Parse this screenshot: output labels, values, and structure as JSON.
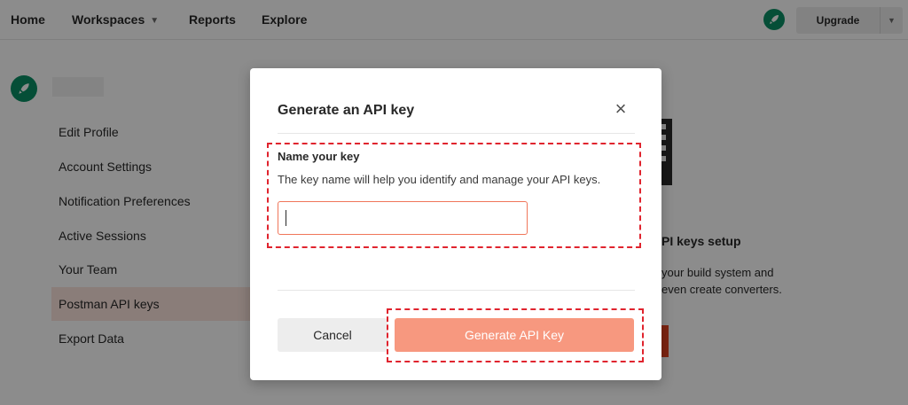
{
  "nav": {
    "home": "Home",
    "workspaces": "Workspaces",
    "reports": "Reports",
    "explore": "Explore",
    "upgrade": "Upgrade"
  },
  "sidebar": {
    "items": [
      {
        "label": "Edit Profile"
      },
      {
        "label": "Account Settings"
      },
      {
        "label": "Notification Preferences"
      },
      {
        "label": "Active Sessions"
      },
      {
        "label": "Your Team"
      },
      {
        "label": "Postman API keys",
        "active": true
      },
      {
        "label": "Export Data"
      }
    ]
  },
  "background": {
    "title_fragment": "PI keys setup",
    "line1_fragment": "your build system and",
    "line2_fragment": "even create converters."
  },
  "modal": {
    "title": "Generate an API key",
    "field_label": "Name your key",
    "field_description": "The key name will help you identify and manage your API keys.",
    "input_value": "",
    "cancel_label": "Cancel",
    "generate_label": "Generate API Key"
  },
  "colors": {
    "accent_orange": "#f7987f",
    "input_border": "#f0765a",
    "highlight_dash": "#e0242e",
    "brand_green": "#0a8f64",
    "active_sidebar_bg": "#fbe4dd"
  },
  "icons": {
    "close": "close-icon",
    "avatar": "rocket-icon",
    "dropdown": "chevron-down-icon"
  }
}
